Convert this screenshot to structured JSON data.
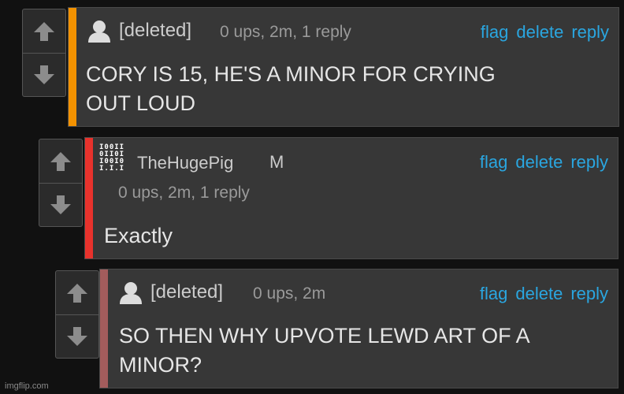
{
  "colors": {
    "background": "#111111",
    "card": "#373737",
    "link": "#2aa6e0",
    "bar_orange": "#f39200",
    "bar_red": "#e8322c",
    "bar_muted": "#a35c5c"
  },
  "comments": [
    {
      "username": "[deleted]",
      "meta": "0 ups, 2m, 1 reply",
      "actions": {
        "flag": "flag",
        "delete": "delete",
        "reply": "reply"
      },
      "body": "CORY IS 15, HE'S A MINOR FOR CRYING\nOUT LOUD",
      "avatar_icon": "user-silhouette-icon"
    },
    {
      "username": "TheHugePig",
      "flair": "M",
      "meta": "0 ups, 2m, 1 reply",
      "actions": {
        "flag": "flag",
        "delete": "delete",
        "reply": "reply"
      },
      "body": "Exactly",
      "avatar_icon": "binary-avatar-icon",
      "avatar_lines": [
        "I00II",
        "0II0I",
        "I00I0",
        "I.I.I"
      ]
    },
    {
      "username": "[deleted]",
      "meta": "0 ups, 2m",
      "actions": {
        "flag": "flag",
        "delete": "delete",
        "reply": "reply"
      },
      "body": "SO THEN WHY UPVOTE LEWD ART OF A\nMINOR?",
      "avatar_icon": "user-silhouette-icon"
    }
  ],
  "vote_icons": {
    "up": "arrow-up-icon",
    "down": "arrow-down-icon"
  },
  "watermark": "imgflip.com"
}
